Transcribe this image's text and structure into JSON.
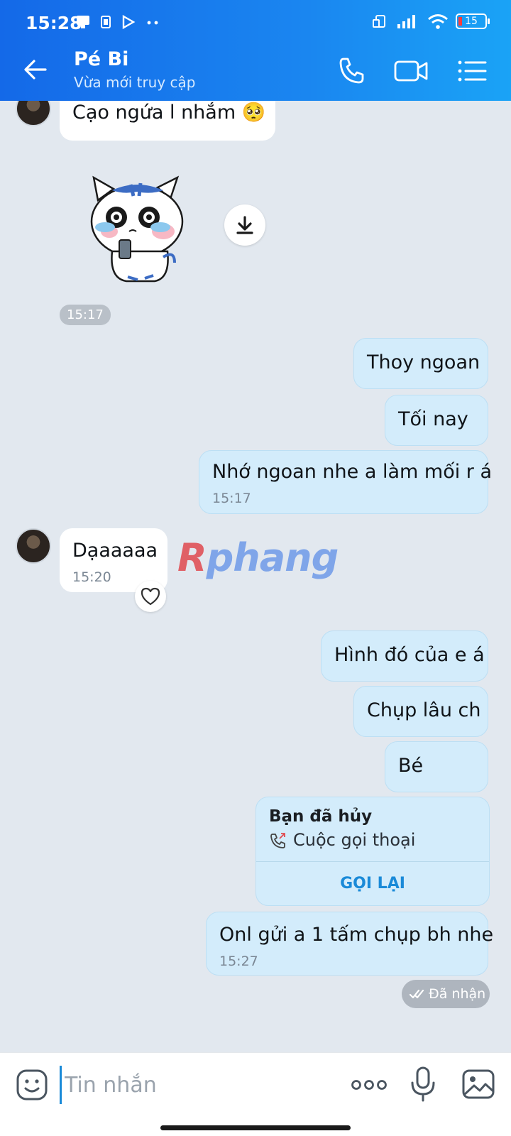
{
  "status_bar": {
    "time": "15:28",
    "battery": "15"
  },
  "header": {
    "name": "Pé Bi",
    "status": "Vừa mới truy cập"
  },
  "messages": [
    {
      "side": "in",
      "text": "Cạo ngứa l nhắm 🥺",
      "time": ""
    },
    {
      "side": "in",
      "sticker": "crying-cat-sticker",
      "time": "15:17"
    },
    {
      "side": "out",
      "text": "Thoy ngoan",
      "time": ""
    },
    {
      "side": "out",
      "text": "Tối nay",
      "time": ""
    },
    {
      "side": "out",
      "text": "Nhớ ngoan nhe a làm mối r á",
      "time": "15:17"
    },
    {
      "side": "in",
      "text": "Dạaaaaa",
      "time": "15:20"
    },
    {
      "side": "out",
      "text": "Hình đó của e á",
      "time": ""
    },
    {
      "side": "out",
      "text": "Chụp lâu ch",
      "time": ""
    },
    {
      "side": "out",
      "text": "Bé",
      "time": ""
    },
    {
      "side": "out",
      "text": "Onl gửi a 1 tấm chụp bh nhe",
      "time": "15:27"
    }
  ],
  "call_card": {
    "title": "Bạn đã hủy",
    "subtitle": "Cuộc gọi thoại",
    "action": "GỌI LẠI"
  },
  "receipt": "Đã nhận",
  "watermark": {
    "first": "R",
    "rest": "phang"
  },
  "composer": {
    "placeholder": "Tin nhắn"
  },
  "colors": {
    "header": "#1a86f0",
    "outgoing_bubble": "#d3ecfb",
    "incoming_bubble": "#ffffff",
    "accent": "#1a8ad8"
  }
}
